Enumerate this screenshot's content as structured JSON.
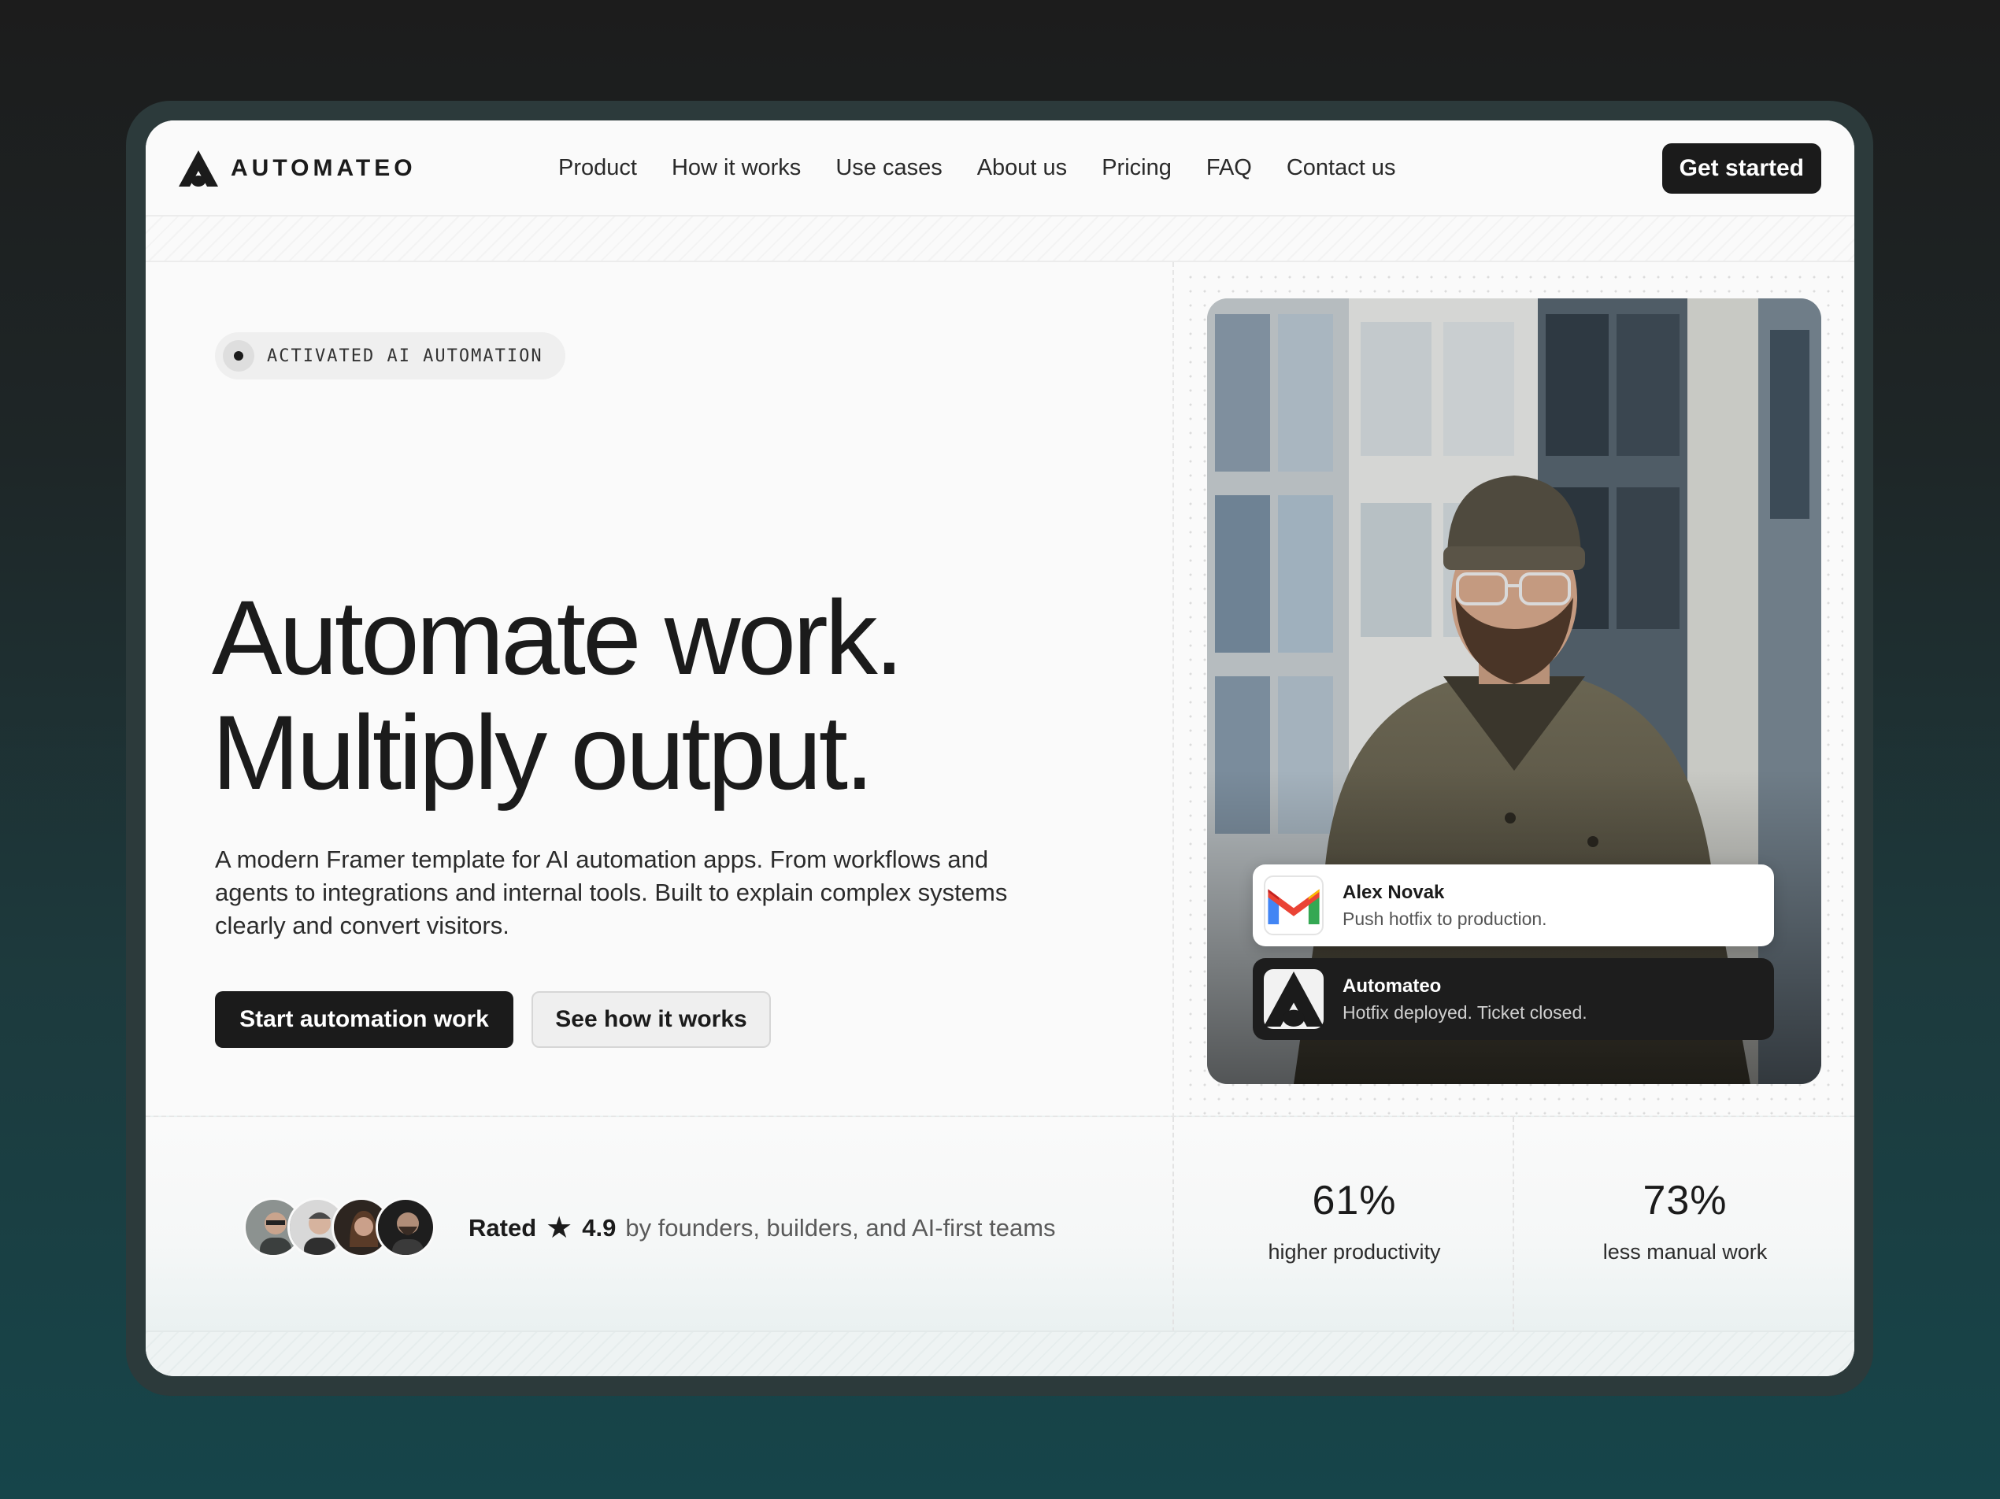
{
  "brand": {
    "name": "AUTOMATEO"
  },
  "nav": {
    "links": [
      "Product",
      "How it works",
      "Use cases",
      "About us",
      "Pricing",
      "FAQ",
      "Contact us"
    ],
    "cta": "Get started"
  },
  "hero": {
    "badge": "ACTIVATED AI AUTOMATION",
    "headline": [
      "Automate work.",
      "Multiply output."
    ],
    "subtitle": "A modern Framer template for AI automation apps. From workflows and agents to integrations and internal tools. Built to explain complex systems clearly and convert visitors.",
    "primary_button": "Start automation work",
    "secondary_button": "See how it works"
  },
  "notifications": [
    {
      "icon": "gmail-icon",
      "name": "Alex Novak",
      "message": "Push hotfix to production."
    },
    {
      "icon": "automateo-logo-icon",
      "name": "Automateo",
      "message": "Hotfix deployed. Ticket closed."
    }
  ],
  "social_proof": {
    "rated": "Rated",
    "score": "4.9",
    "text": "by founders, builders, and AI-first teams"
  },
  "stats": [
    {
      "value": "61%",
      "label": "higher productivity"
    },
    {
      "value": "73%",
      "label": "less manual work"
    }
  ],
  "colors": {
    "accent": "#1b1b1b",
    "page_bg": "#fafafa",
    "backdrop_top": "#1c1c1c",
    "backdrop_bottom": "#16454a"
  }
}
